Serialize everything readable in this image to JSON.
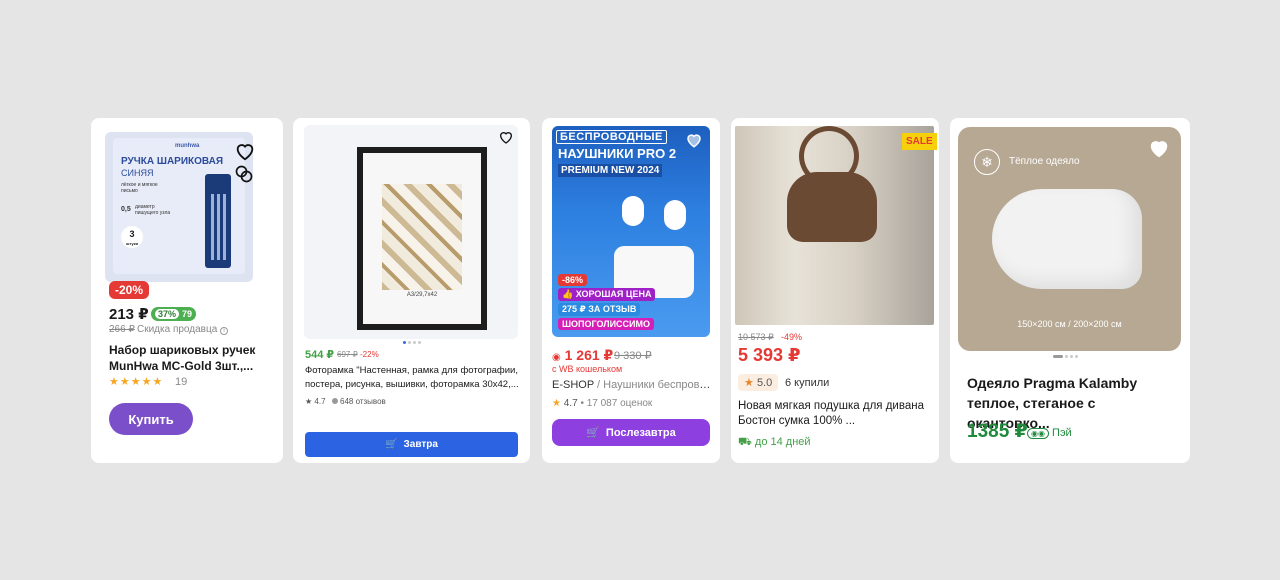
{
  "cards": [
    {
      "image_title": "РУЧКА ШАРИКОВАЯ",
      "image_subtitle": "СИНЯЯ",
      "image_brand": "munhwa",
      "image_count": "3",
      "image_count_label": "штуки",
      "image_feature_1": "лёгкое и мягкое письмо",
      "image_feature_2": "диаметр пишущего узла",
      "image_diameter": "0,5",
      "discount_badge": "-20%",
      "price": "213 ₽",
      "wallet_percent": "37%",
      "wallet_price": "79",
      "old_price": "266 ₽",
      "seller_discount_label": "Скидка продавца",
      "title": "Набор шариковых ручек MunHwa MC-Gold 3шт.,...",
      "stars": "★★★★★",
      "reviews_count": "19",
      "buy_button": "Купить"
    },
    {
      "frame_label": "A3/29,7x42",
      "price": "544 ₽",
      "old_price": "697 ₽",
      "discount": "-22%",
      "title": "Фоторамка \"Настенная, рамка для фотографии, постера, рисунка, вышивки, фоторамка 30x42,...",
      "rating": "★ 4.7",
      "reviews": "648 отзывов",
      "delivery_button": "Завтра"
    },
    {
      "image_tag_1": "БЕСПРОВОДНЫЕ",
      "image_tag_2": "НАУШНИКИ PRO 2",
      "image_tag_3": "PREMIUM NEW 2024",
      "badge_discount": "-86%",
      "badge_good_price": "ХОРОШАЯ ЦЕНА",
      "badge_review": "275 ₽ ЗА ОТЗЫВ",
      "badge_shopping": "ШОПОГОЛИССИМО",
      "price": "1 261 ₽",
      "old_price": "9 330 ₽",
      "wallet_note": "с WB кошельком",
      "brand": "E-SHOP",
      "category": "/ Наушники беспрово...",
      "rating": "4.7",
      "reviews": "• 17 087 оценок",
      "delivery_button": "Послезавтра"
    },
    {
      "sale_tag": "SALE",
      "old_price": "10 573 ₽",
      "discount": "-49%",
      "price": "5 393 ₽",
      "rating": "5.0",
      "sold": "6 купили",
      "title": "Новая мягкая подушка для дивана Бостон сумка 100% ...",
      "delivery": "до 14 дней"
    },
    {
      "image_label": "Тёплое одеяло",
      "image_sizes": "150×200 см / 200×200 см",
      "title": "Одеяло Pragma Kalamby теплое, стеганое с окантовко...",
      "price": "1385 ₽",
      "pay_label": "Пэй"
    }
  ],
  "colors": {
    "background": "#e5e5e5",
    "accent_purple": "#7b4fc9",
    "accent_blue": "#2b63e3",
    "accent_violet": "#8e3fe0",
    "price_red": "#e53935",
    "price_green": "#1f8a3c"
  },
  "icons": [
    "heart-icon",
    "compare-icon",
    "cart-icon",
    "basket-icon",
    "star-icon",
    "truck-icon",
    "snowflake-icon",
    "info-icon"
  ]
}
